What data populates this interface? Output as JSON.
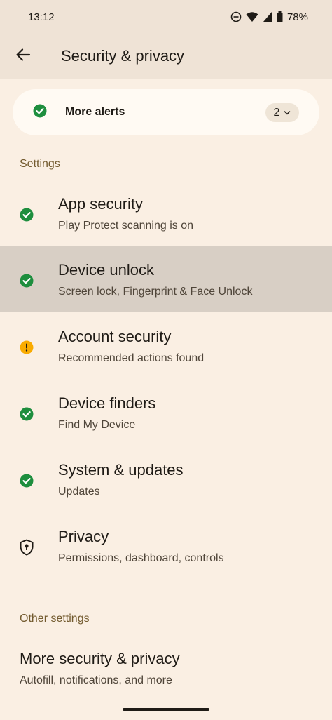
{
  "status_bar": {
    "time": "13:12",
    "battery": "78%",
    "icons": [
      "dnd-icon",
      "wifi-icon",
      "cellular-icon",
      "battery-icon"
    ]
  },
  "app_bar": {
    "title": "Security & privacy",
    "back_icon": "arrow-back-icon"
  },
  "alerts": {
    "label": "More alerts",
    "count": "2",
    "icon": "check-circle-icon"
  },
  "settings_section": {
    "header": "Settings",
    "items": [
      {
        "title": "App security",
        "subtitle": "Play Protect scanning is on",
        "status": "ok",
        "icon": "check-circle-icon"
      },
      {
        "title": "Device unlock",
        "subtitle": "Screen lock, Fingerprint & Face Unlock",
        "status": "ok",
        "icon": "check-circle-icon",
        "pressed": true
      },
      {
        "title": "Account security",
        "subtitle": "Recommended actions found",
        "status": "warning",
        "icon": "warning-circle-icon"
      },
      {
        "title": "Device finders",
        "subtitle": "Find My Device",
        "status": "ok",
        "icon": "check-circle-icon"
      },
      {
        "title": "System & updates",
        "subtitle": "Updates",
        "status": "ok",
        "icon": "check-circle-icon"
      },
      {
        "title": "Privacy",
        "subtitle": "Permissions, dashboard, controls",
        "status": "neutral",
        "icon": "shield-keyhole-icon"
      }
    ]
  },
  "other_section": {
    "header": "Other settings",
    "items": [
      {
        "title": "More security & privacy",
        "subtitle": "Autofill, notifications, and more"
      }
    ]
  },
  "colors": {
    "background": "#faefe3",
    "app_bar": "#efe3d6",
    "ok_green": "#1e8e3e",
    "warning_yellow": "#f9ab00",
    "section_header": "#725a2e",
    "pressed_row": "#d8cfc5"
  }
}
